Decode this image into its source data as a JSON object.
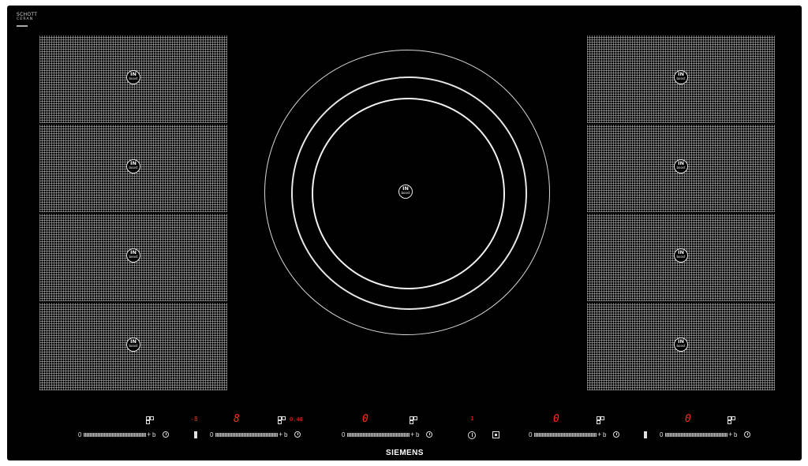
{
  "glass_brand": {
    "line1": "SCHOTT",
    "line2": "CERAN"
  },
  "zones": {
    "inboost": {
      "top": "IN",
      "bottom": "boost"
    },
    "left_count": 4,
    "right_count": 4
  },
  "control_panel": {
    "displays": {
      "left_small": "-8",
      "left_zone": "8",
      "left_small_label": "0.48",
      "center_zone": "0",
      "center_indicator": "1",
      "right_zone": "0",
      "far_right_zone": "0"
    },
    "slider_min": "0",
    "slider_plus": "+",
    "slider_boost": "b"
  },
  "brand": "SIEMENS",
  "colors": {
    "glass": "#000000",
    "display": "#ff2a1a",
    "markings": "#e6e6e6"
  }
}
